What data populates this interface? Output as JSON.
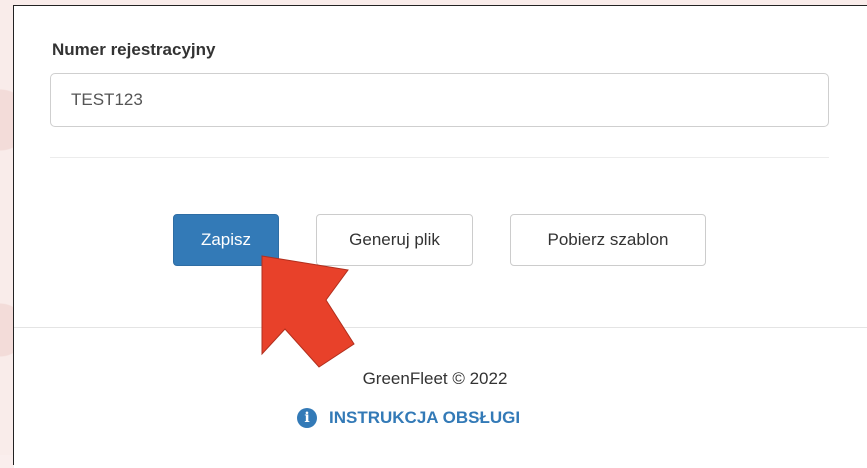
{
  "form": {
    "registration_label": "Numer rejestracyjny",
    "registration_value": "TEST123"
  },
  "actions": {
    "save_label": "Zapisz",
    "generate_label": "Generuj plik",
    "template_label": "Pobierz szablon"
  },
  "footer": {
    "copyright": "GreenFleet © 2022",
    "manual_label": "INSTRUKCJA OBSŁUGI",
    "manual_icon": "info-circle-icon"
  },
  "annotation": {
    "arrow_color": "#e8412a",
    "arrow_target": "generate-file-button"
  },
  "colors": {
    "primary": "#337ab7",
    "link": "#337ab7"
  }
}
